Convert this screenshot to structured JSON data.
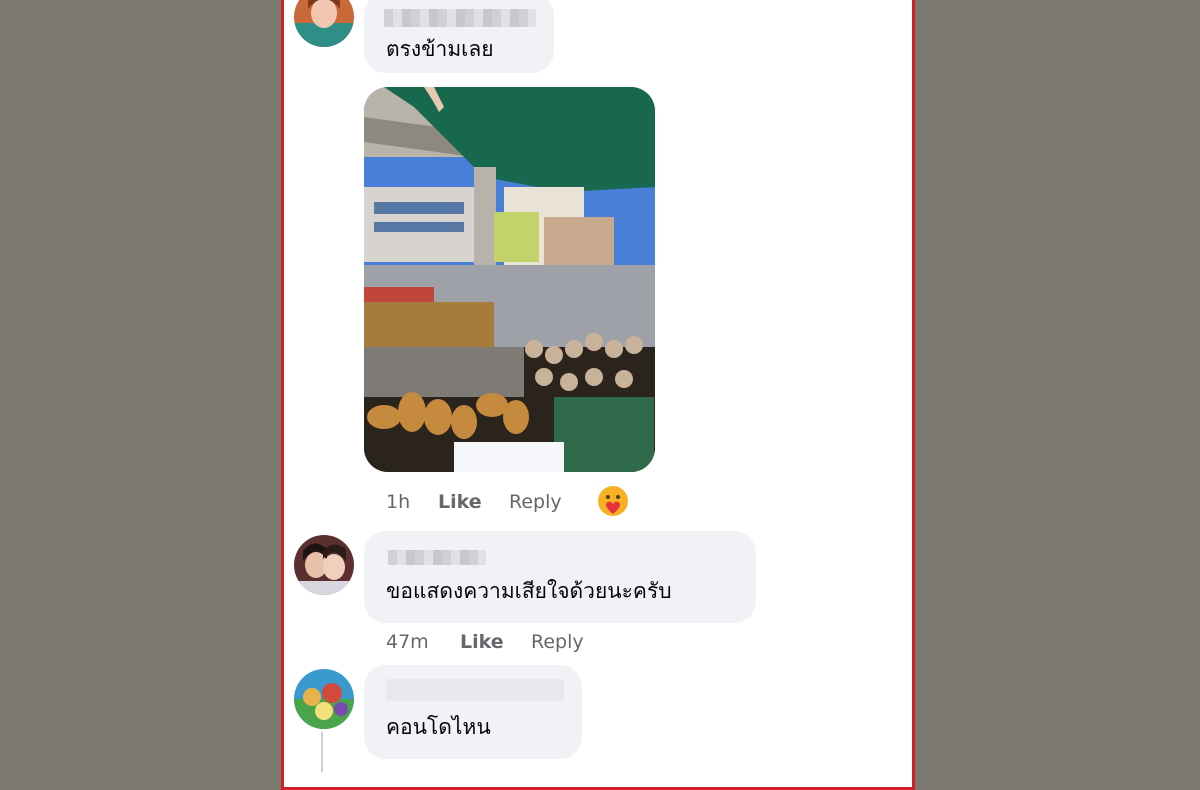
{
  "comments": [
    {
      "text": "ตรงข้ามเลย"
    },
    {
      "photo_alt": "Street food stall photo",
      "time": "1h",
      "like_label": "Like",
      "reply_label": "Reply",
      "reaction": "care"
    },
    {
      "text": "ขอแสดงความเสียใจด้วยนะครับ",
      "time": "47m",
      "like_label": "Like",
      "reply_label": "Reply"
    },
    {
      "text": "คอนโดไหน"
    }
  ],
  "colors": {
    "page_background": "#7b7870",
    "frame_border": "#d21f26",
    "bubble": "#f0f2f5",
    "meta_text": "#65676b"
  }
}
